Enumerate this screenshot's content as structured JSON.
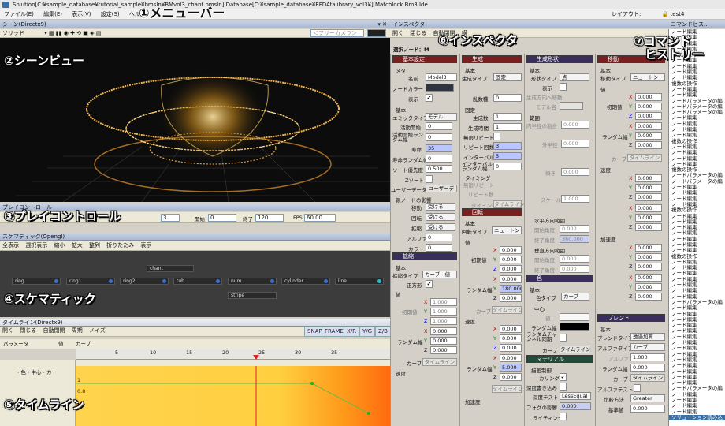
{
  "window": {
    "title": "Solution[C:¥sample_database¥tutorial_sample¥bmsln¥BMvol3_chant.bmsln]    Database[C:¥sample_database¥EFDAtalibrary_vol3¥]    Matchlock.Bm3.Ide",
    "layout_label": "レイアウト:",
    "layout_value": "test4"
  },
  "menu": [
    "ファイル(E)",
    "編集(E)",
    "表示(V)",
    "設定(S)",
    "ヘル"
  ],
  "callouts": {
    "menubar": "①メニューバー",
    "sceneview": "②シーンビュー",
    "playcontrol": "③プレイコントロール",
    "schematic": "④スケマティック",
    "timeline": "⑤タイムライン",
    "inspector": "⑥インスペクタ",
    "history_line1": "⑦コマンド",
    "history_line2": "ヒストリー"
  },
  "scene": {
    "header": "シーン(Directx9)",
    "render_mode": "ソリッド",
    "camera_placeholder": "＜フリーカメラ＞"
  },
  "play": {
    "header": "プレイコントロール",
    "frame_value": "3",
    "start_label": "開始",
    "start_value": "0",
    "end_label": "終了",
    "end_value": "120",
    "fps_label": "FPS",
    "fps_value": "60.00"
  },
  "schematic": {
    "header": "スケマティック(Opengl)",
    "toolbar": [
      "全表示",
      "選択表示",
      "縮小",
      "拡大",
      "整列",
      "折りたたみ",
      "表示"
    ],
    "root": "chant",
    "nodes": [
      "ring",
      "ring1",
      "ring2",
      "tub",
      "num",
      "cylinder",
      "line"
    ],
    "child": "stripe"
  },
  "timeline": {
    "tab": "タイムライン(Directx9)",
    "toolbar": [
      "開く",
      "閉じる",
      "自動閉開",
      "周期",
      "ノイズ"
    ],
    "buttons": [
      "SNAP",
      "FRAME",
      "X/R",
      "Y/G",
      "Z/B"
    ],
    "col_param": "パラメータ",
    "col_value": "値",
    "col_curve": "カーブ",
    "ruler": [
      "5",
      "10",
      "15",
      "20",
      "25",
      "30",
      "35"
    ],
    "track_label": "・色・中心・カー",
    "track_values": [
      "1",
      "0.8"
    ]
  },
  "inspector": {
    "header": "インスペクタ",
    "toolbar": [
      "開く",
      "閉じる",
      "自動閉開",
      "横"
    ],
    "selected_node": "選択ノード：M",
    "col1": {
      "section": "基本設定",
      "meta": "メタ",
      "name_label": "名前",
      "name_value": "Model3",
      "nodecolor_label": "ノードカラー",
      "display_label": "表示",
      "basic": "基本",
      "emitter_label": "エミッタタイプ",
      "emitter_value": "モデル",
      "active_start_label": "活動開始",
      "active_start_value": "0",
      "active_rand_label": "活動開始ランダム幅",
      "active_rand_value": "0",
      "life_label": "寿命",
      "life_value": "35",
      "life_rand_label": "寿命ランダム幅",
      "life_rand_value": "0",
      "sort_label": "ソート優先度",
      "sort_value": "0.500",
      "zsort_label": "Zソート",
      "userdata_label": "ユーザーデータ",
      "userdata_btn": "ユーザーデ",
      "parent": "親ノードの影響",
      "move_label": "移動",
      "move_value": "受ける",
      "rotate_label": "回転",
      "rotate_value": "受ける",
      "scale_label": "拡縮",
      "scale_value": "受ける",
      "alpha_label": "アルファ",
      "alpha_value": "0",
      "color_label": "カラー",
      "color_value": "0",
      "section2": "拡縮",
      "basic2": "基本",
      "scale_type_label": "拡縮タイプ",
      "scale_type_value": "カーブ - 値",
      "square_label": "正方形",
      "value": "値",
      "init_label": "初期値",
      "init_values": [
        "1.000",
        "1.000",
        "1.000"
      ],
      "rand_label": "ランダム幅",
      "rand_values": [
        "0.000",
        "0.000",
        "0.000"
      ],
      "curve_label": "カーブ",
      "curve_btn": "タイムライン",
      "speed": "速度"
    },
    "col2": {
      "section": "生成",
      "basic": "基本",
      "gen_type_label": "生成タイプ",
      "gen_type_value": "固定",
      "seed_label": "乱数種",
      "seed_value": "0",
      "fixed": "固定",
      "gen_count_label": "生成数",
      "gen_count_value": "1",
      "gen_time_label": "生成時間",
      "gen_time_value": "1",
      "infinite_label": "無限リピート",
      "repeat_label": "リピート回数",
      "repeat_value": "3",
      "interval_label": "インターバル",
      "interval_value": "5",
      "interval_rand_label": "インターバルランダム幅",
      "interval_rand_value": "0",
      "timing": "タイミング",
      "timing_infinite": "無限リピート",
      "timing_repeat": "リピート数",
      "timing_curve": "タイミング",
      "timing_btn": "タイムライン",
      "section2": "回転",
      "basic2": "基本",
      "rot_type_label": "回転タイプ",
      "rot_type_value": "ニュートン",
      "value": "値",
      "init_label": "初期値",
      "init_values": [
        "0.000",
        "0.000",
        "0.000"
      ],
      "rand_label": "ランダム幅",
      "rand_values": [
        "0.000",
        "180.000",
        "0.000"
      ],
      "curve_label": "カーブ",
      "curve_btn": "タイムライン",
      "speed": "速度",
      "speed_init_values": [
        "0.000",
        "0.000",
        "0.000"
      ],
      "speed_rand_label": "ランダム幅",
      "speed_rand_values": [
        "0.000",
        "5.000",
        "0.000"
      ],
      "speed_curve_btn": "タイムライン",
      "accel": "加速度"
    },
    "col3": {
      "section": "生成形状",
      "basic": "基本",
      "shape_type_label": "形状タイプ",
      "shape_type_value": "点",
      "display_label": "表示",
      "dir_label": "生成方向へ移動",
      "model_label": "モデル名",
      "range": "範囲",
      "in_ratio_label": "内半径の割合",
      "in_ratio_value": "0.000",
      "radius_label": "外半径",
      "radius_value": "0.000",
      "tilt_label": "傾き",
      "tilt_value": "0.000",
      "scale_label": "スケール",
      "scale_value": "1.000",
      "hdir": "水平方向範囲",
      "h_start_label": "開始角度",
      "h_start_value": "0.000",
      "h_end_label": "終了角度",
      "h_end_value": "360.000",
      "vdir": "垂直方向範囲",
      "v_start_label": "開始角度",
      "v_start_value": "0.000",
      "v_end_label": "終了角度",
      "v_end_value": "0.000",
      "section2": "色",
      "basic2": "基本",
      "color_type_label": "色タイプ",
      "color_type_value": "カーブ",
      "center": "中心",
      "value_label": "値",
      "rand_label": "ランダム幅",
      "rand_channel_label": "ランダムチャンネル同期",
      "curve_label": "カーブ",
      "curve_btn": "タイムライン",
      "section3": "マテリアル",
      "draw_label": "描画制御",
      "culling_label": "カリング",
      "depth_write_label": "深度書き込み",
      "depth_test_label": "深度テスト",
      "depth_test_value": "LessEqual",
      "fog_label": "フォグの影響",
      "fog_value": "0.000",
      "lighting_label": "ライティング"
    },
    "col4": {
      "section": "移動",
      "basic": "基本",
      "move_type_label": "移動タイプ",
      "move_type_value": "ニュートン",
      "value": "値",
      "init_label": "初期値",
      "init_values": [
        "0.000",
        "0.000",
        "0.000"
      ],
      "rand_label": "ランダム幅",
      "rand_values": [
        "0.000",
        "0.000",
        "0.000"
      ],
      "curve_label": "カーブ",
      "curve_btn": "タイムライン",
      "speed": "速度",
      "speed_init_values": [
        "0.000",
        "0.000",
        "0.000"
      ],
      "speed_rand_values": [
        "0.000",
        "0.000",
        "0.000"
      ],
      "accel": "加速度",
      "accel_init_values": [
        "0.000",
        "0.000",
        "0.000"
      ],
      "accel_rand_values": [
        "0.000",
        "0.000",
        "0.000"
      ],
      "section2": "ブレンド",
      "basic2": "基本",
      "blend_type_label": "ブレンドタイプ",
      "blend_type_value": "透過加算",
      "alpha_type_label": "アルファタイプ",
      "alpha_type_value": "カーブ",
      "alpha_label": "アルファ",
      "alpha_value": "1.000",
      "rand_label2": "ランダム幅",
      "rand_value2": "0.000",
      "curve_label2": "カーブ",
      "curve_btn2": "タイムライン",
      "alphatest_label": "アルファテスト",
      "compare_label": "比較方法",
      "compare_value": "Greater",
      "ref_label": "基準値",
      "ref_value": "0.000"
    }
  },
  "history": {
    "header": "コマンドヒス...",
    "items": [
      "ノード編集",
      "ノード編集",
      "ノード編集",
      "ノード編集",
      "複数の操作",
      "ノード編集",
      "ノード編集",
      "ノード編集",
      "ノード編集",
      "複数の操作",
      "ノード編集",
      "ノード編集",
      "ノードパラメータの編",
      "ノードパラメータの編",
      "ノードパラメータの編",
      "ノード編集",
      "ノード編集",
      "ノード編集",
      "ノード編集",
      "複数の操作",
      "ノード編集",
      "ノード編集",
      "ノード編集",
      "ノード編集",
      "複数の操作",
      "ノードパラメータの編",
      "ノードパラメータの編",
      "ノード編集",
      "ノード編集",
      "ノード編集",
      "ノード編集",
      "複数の操作",
      "ノード編集",
      "ノード編集",
      "ノード編集",
      "ノード編集",
      "ノード編集",
      "ノード編集",
      "ノード編集",
      "複数の操作",
      "ノード編集",
      "ノード編集",
      "ノード編集",
      "ノード編集",
      "ノード編集",
      "ノード編集",
      "ノード編集",
      "ノードパラメータの編",
      "ノード編集",
      "ノード編集",
      "ノード編集",
      "ノード編集",
      "ノード編集",
      "ノード編集",
      "ノード編集",
      "ノード編集",
      "ノード編集",
      "ノード編集",
      "ノード編集",
      "ノード編集",
      "ノード編集",
      "ノード編集",
      "ノードパラメータの編",
      "ノード編集",
      "ノード編集",
      "ノード編集",
      "ノード編集",
      "ソリューション読み込"
    ]
  },
  "colors": {
    "accent": "#3a6ea5",
    "section_red": "#7a1f1f",
    "section_purple": "#3a2f5a",
    "timeline_fill": "#ffd34d",
    "timeline_end": "#ff8a1a"
  }
}
